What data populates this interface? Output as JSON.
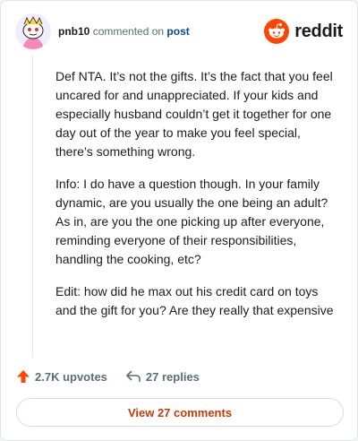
{
  "comment": {
    "username": "pnb10",
    "commented_text": "commented on",
    "post_link": "post",
    "paragraphs": [
      "Def NTA. It’s not the gifts. It’s the fact that you feel uncared for and unappreciated. If your kids and especially husband couldn’t get it together for one day out of the year to make you feel special, there’s something wrong.",
      "Info: I do have a question though. In your family dynamic, are you usually the one being an adult? As in, are you the one picking up after everyone, reminding everyone of their responsibilities, handling the cooking, etc?",
      "Edit: how did he max out his credit card on toys and the gift for you? Are they really that expensive"
    ]
  },
  "brand": {
    "name": "reddit",
    "color": "#ff4500"
  },
  "actions": {
    "upvotes": "2.7K upvotes",
    "replies": "27 replies"
  },
  "view_button": {
    "label": "View 27 comments"
  },
  "colors": {
    "upvote": "#ff4500",
    "accent_link": "#0a449b",
    "button_text": "#c23a0c"
  },
  "icons": {
    "upvote": "upvote-arrow-icon",
    "reply": "reply-arrow-icon",
    "logo": "reddit-snoo-icon",
    "avatar": "snoo-avatar"
  }
}
